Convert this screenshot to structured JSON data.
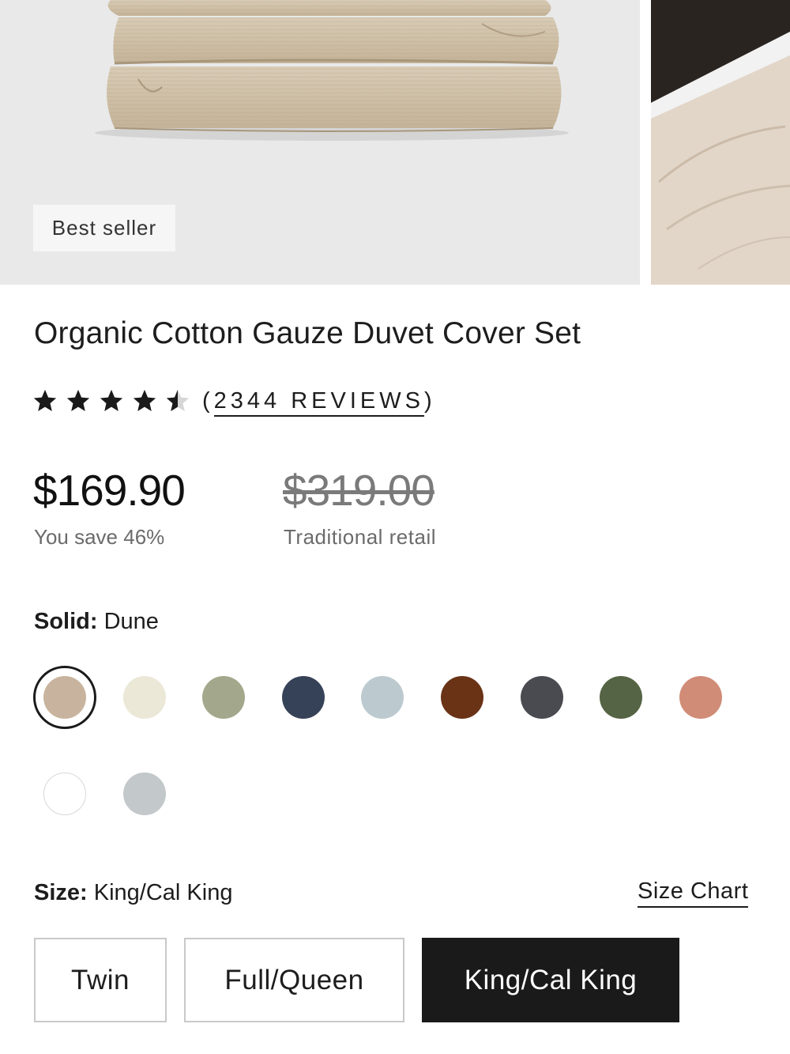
{
  "gallery": {
    "badge": "Best seller"
  },
  "product": {
    "title": "Organic Cotton Gauze Duvet Cover Set",
    "rating_stars": 4.5,
    "reviews_open": "(",
    "reviews_label": "2344 REVIEWS",
    "reviews_close": ")",
    "price": "$169.90",
    "savings": "You save 46%",
    "retail_price": "$319.00",
    "retail_label": "Traditional retail"
  },
  "color": {
    "label": "Solid:",
    "selected": "Dune",
    "swatches": [
      "#c8b49e",
      "#ebe8d8",
      "#a3a88c",
      "#364257",
      "#bccacf",
      "#6a3316",
      "#4a4b50",
      "#556444",
      "#d08c77",
      "#ffffff",
      "#c3c8cb"
    ]
  },
  "size": {
    "label": "Size:",
    "selected": "King/Cal King",
    "chart_link": "Size Chart",
    "options": [
      "Twin",
      "Full/Queen",
      "King/Cal King"
    ]
  },
  "colors": {
    "accent": "#1a1a1a",
    "muted_text": "#6b6b6b",
    "image_bg": "#e9e9e9"
  }
}
